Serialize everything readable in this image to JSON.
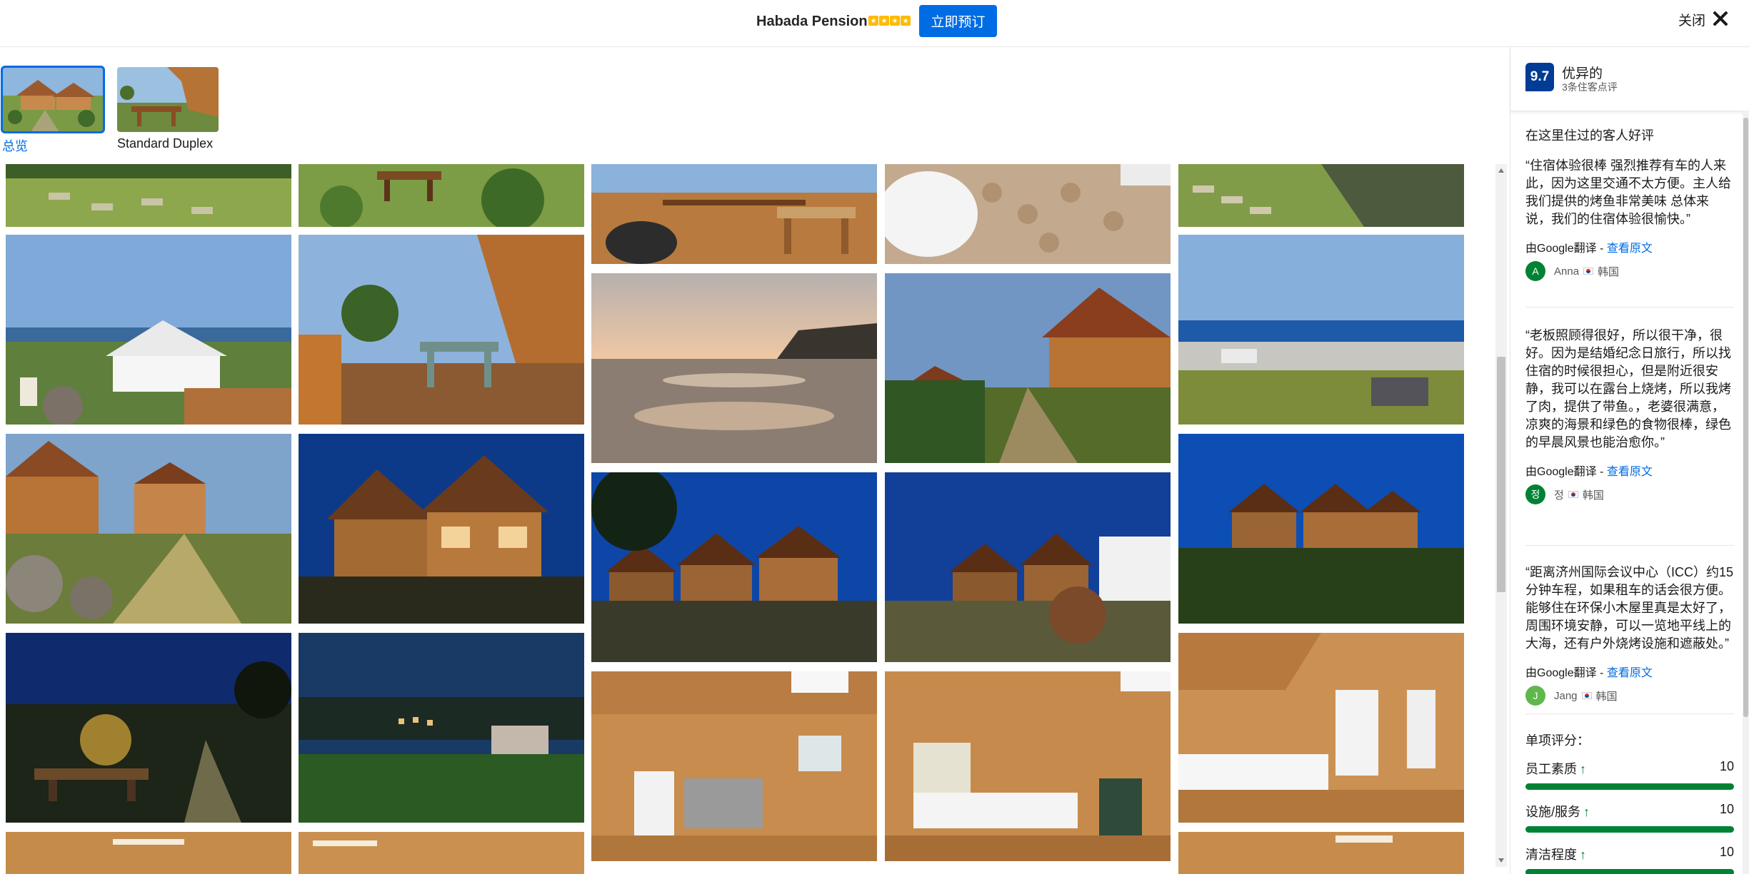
{
  "header": {
    "hotel_name": "Habada Pension",
    "star_rating": 4,
    "book_label": "立即预订",
    "close_label": "关闭"
  },
  "categories": [
    {
      "label": "总览",
      "active": true
    },
    {
      "label": "Standard Duplex",
      "active": false
    }
  ],
  "score": {
    "value": "9.7",
    "word": "优异的",
    "count": "3条住客点评"
  },
  "reviews_title": "在这里住过的客人好评",
  "reviews": [
    {
      "quote": "“住宿体验很棒 强烈推荐有车的人来此，因为这里交通不太方便。主人给我们提供的烤鱼非常美味 总体来说，我们的住宿体验很愉快。”",
      "translated_by": "由Google翻译 - ",
      "show_original": "查看原文",
      "author_initial": "A",
      "author": "Anna",
      "country": "韩国",
      "avatar_color": "#008234"
    },
    {
      "quote": "“老板照顾得很好，所以很干净，很好。因为是结婚纪念日旅行，所以找住宿的时候很担心，但是附近很安静，我可以在露台上烧烤，所以我烤了肉，提供了带鱼。，老婆很满意，凉爽的海景和绿色的食物很棒，绿色的早晨风景也能治愈你。”",
      "translated_by": "由Google翻译 - ",
      "show_original": "查看原文",
      "author_initial": "정",
      "author": "정",
      "country": "韩国",
      "avatar_color": "#008234"
    },
    {
      "quote": "“距离济州国际会议中心（ICC）约15分钟车程，如果租车的话会很方便。能够住在环保小木屋里真是太好了，周围环境安静，可以一览地平线上的大海，还有户外烧烤设施和遮蔽处。”",
      "translated_by": "由Google翻译 - ",
      "show_original": "查看原文",
      "author_initial": "J",
      "author": "Jang",
      "country": "韩国",
      "avatar_color": "#5eb84b"
    }
  ],
  "subscores_title": "单项评分：",
  "subscores": [
    {
      "label": "员工素质",
      "value": "10",
      "fraction": 1.0
    },
    {
      "label": "设施/服务",
      "value": "10",
      "fraction": 1.0
    },
    {
      "label": "清洁程度",
      "value": "10",
      "fraction": 1.0
    }
  ],
  "colors": {
    "brand_blue": "#006ce4",
    "score_blue": "#003b95",
    "green": "#008234",
    "star_yellow": "#febb02"
  },
  "icons": [
    "close-icon",
    "up-arrow-icon",
    "star-icon",
    "flag-korea-icon"
  ]
}
